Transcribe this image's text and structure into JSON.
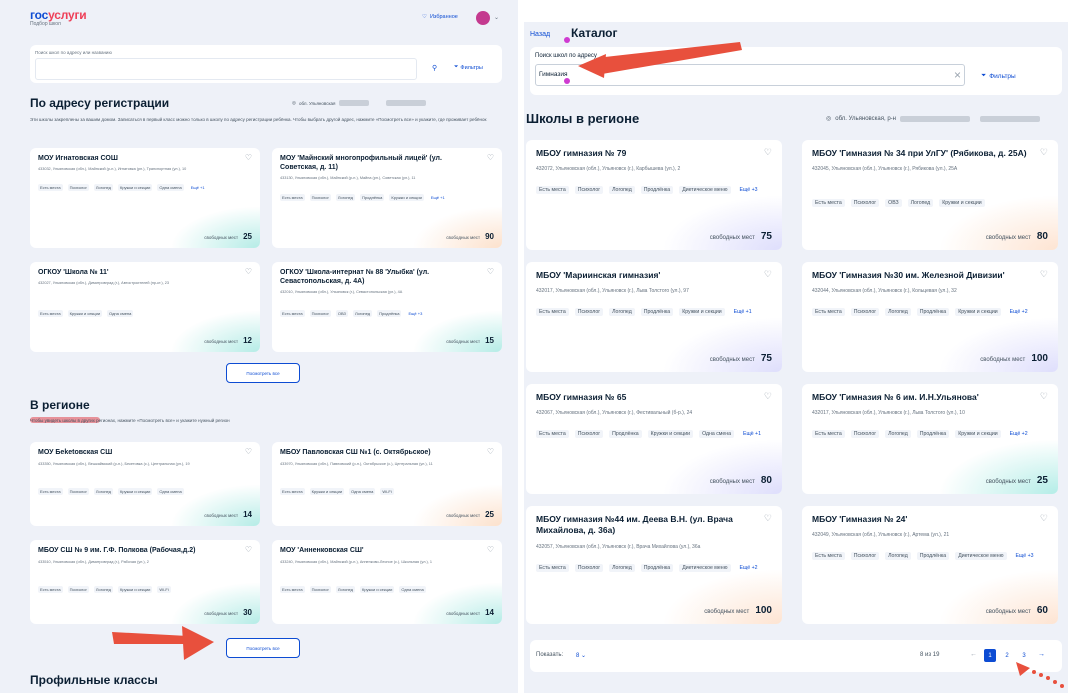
{
  "left": {
    "logo": {
      "part1": "гос",
      "part2": "услуги",
      "sub": "Подбор школ"
    },
    "header": {
      "favorites": "Избранное"
    },
    "search": {
      "label": "Поиск школ по адресу или названию",
      "filters": "Фильтры"
    },
    "section1": {
      "title": "По адресу регистрации",
      "region": "обл. Ульяновская",
      "note": "Эти школы закреплены за вашим домом. Записаться в первый класс можно только в школу по адресу регистрации ребёнка. Чтобы выбрать другой адрес, нажмите «Посмотреть все» и укажите, где проживает ребёнок"
    },
    "cards1": [
      {
        "name": "МОУ Игнатовская СОШ",
        "address": "433032, Ульяновская (обл.), Майнский (р-н.), Игнатовка (рп.), Транспортная (ул.), 10",
        "tags": [
          "Есть места",
          "Психолог",
          "Логопед",
          "Кружки и секции",
          "Одна смена",
          "Ещё +1"
        ],
        "free_label": "свободных мест",
        "free": "25"
      },
      {
        "name": "МОУ 'Майнский многопрофильный лицей' (ул. Советская, д. 11)",
        "address": "433130, Ульяновская (обл.), Майнский (р-н.), Майна (рп.), Советская (ул.), 11",
        "tags": [
          "Есть места",
          "Психолог",
          "Логопед",
          "Продлёнка",
          "Кружки и секции",
          "Ещё +1"
        ],
        "free_label": "свободных мест",
        "free": "90"
      },
      {
        "name": "ОГКОУ 'Школа № 11'",
        "address": "432027, Ульяновская (обл.), Димитровград (г.), Автостроителей (пр-кт.), 23",
        "tags": [
          "Есть места",
          "Кружки и секции",
          "Одна смена"
        ],
        "free_label": "свободных мест",
        "free": "12"
      },
      {
        "name": "ОГКОУ 'Школа-интернат № 88 'Улыбка' (ул. Севастопольская, д. 4А)",
        "address": "432010, Ульяновская (обл.), Ульяновск (г.), Севастопольская (ул.), 4А",
        "tags": [
          "Есть места",
          "Психолог",
          "ОВЗ",
          "Логопед",
          "Продлёнка",
          "Ещё +3"
        ],
        "free_label": "свободных мест",
        "free": "15"
      }
    ],
    "view_all1": "Посмотреть все",
    "section2": {
      "title": "В регионе",
      "note": "Чтобы увидеть школы в других регионах, нажмите «Посмотреть все» и укажите нужный регион"
    },
    "cards2": [
      {
        "name": "МОУ Беketовская СШ",
        "address": "433350, Ульяновская (обл.), Вешкаймский (р-н.), Бекетовка (с.), Центральная (ул.), 19",
        "tags": [
          "Есть места",
          "Психолог",
          "Логопед",
          "Кружки и секции",
          "Одна смена"
        ],
        "free_label": "свободных мест",
        "free": "14"
      },
      {
        "name": "МБОУ Павловская СШ №1 (с. Октябрьское)",
        "address": "433970, Ульяновская (обл.), Павловский (р-н.), Октябрьское (с.), Центральная (ул.), 11",
        "tags": [
          "Есть места",
          "Кружки и секции",
          "Одна смена",
          "Wi-Fi"
        ],
        "free_label": "свободных мест",
        "free": "25"
      },
      {
        "name": "МБОУ СШ № 9 им. Г.Ф. Полкова (Рабочая,д.2)",
        "address": "433510, Ульяновская (обл.), Димитровград (г.), Рабочая (ул.), 2",
        "tags": [
          "Есть места",
          "Психолог",
          "Логопед",
          "Кружки и секции",
          "Wi-Fi"
        ],
        "free_label": "свободных мест",
        "free": "30"
      },
      {
        "name": "МОУ 'Анненковская СШ'",
        "address": "433240, Ульяновская (обл.), Майнский (р-н.), Анненково-Лесное (с.), Школьная (ул.), 1",
        "tags": [
          "Есть места",
          "Психолог",
          "Логопед",
          "Кружки и секции",
          "Одна смена"
        ],
        "free_label": "свободных мест",
        "free": "14"
      }
    ],
    "view_all2": "Посмотреть все",
    "section3": {
      "title": "Профильные классы"
    }
  },
  "right": {
    "back": "Назад",
    "title": "Каталог",
    "search": {
      "label": "Поиск школ по адресу",
      "value": "Гимназия",
      "filters": "Фильтры"
    },
    "section_title": "Школы в регионе",
    "region": "обл. Ульяновская, р-н",
    "cards": [
      {
        "name": "МБОУ гимназия № 79",
        "address": "432072, Ульяновская (обл.), Ульяновск (г.), Карбышева (ул.), 2",
        "tags": [
          "Есть места",
          "Психолог",
          "Логопед",
          "Продлёнка",
          "Диетическое меню",
          "Ещё +3"
        ],
        "free_label": "свободных мест",
        "free": "75"
      },
      {
        "name": "МБОУ 'Гимназия № 34 при УлГУ' (Рябикова, д. 25А)",
        "address": "432045, Ульяновская (обл.), Ульяновск (г.), Рябикова (ул.), 25А",
        "tags": [
          "Есть места",
          "Психолог",
          "ОВЗ",
          "Логопед",
          "Кружки и секции"
        ],
        "free_label": "свободных мест",
        "free": "80"
      },
      {
        "name": "МБОУ 'Мариинская гимназия'",
        "address": "432017, Ульяновская (обл.), Ульяновск (г.), Льва Толстого (ул.), 97",
        "tags": [
          "Есть места",
          "Психолог",
          "Логопед",
          "Продлёнка",
          "Кружки и секции",
          "Ещё +1"
        ],
        "free_label": "свободных мест",
        "free": "75"
      },
      {
        "name": "МБОУ 'Гимназия №30 им. Железной Дивизии'",
        "address": "432044, Ульяновская (обл.), Ульяновск (г.), Кольцевая (ул.), 32",
        "tags": [
          "Есть места",
          "Психолог",
          "Логопед",
          "Продлёнка",
          "Кружки и секции",
          "Ещё +2"
        ],
        "free_label": "свободных мест",
        "free": "100"
      },
      {
        "name": "МБОУ гимназия № 65",
        "address": "432067, Ульяновская (обл.), Ульяновск (г.), Фестивальный (б-р.), 24",
        "tags": [
          "Есть места",
          "Психолог",
          "Продлёнка",
          "Кружки и секции",
          "Одна смена",
          "Ещё +1"
        ],
        "free_label": "свободных мест",
        "free": "80"
      },
      {
        "name": "МБОУ 'Гимназия № 6 им. И.Н.Ульянова'",
        "address": "432017, Ульяновская (обл.), Ульяновск (г.), Льва Толстого (ул.), 10",
        "tags": [
          "Есть места",
          "Психолог",
          "Логопед",
          "Продлёнка",
          "Кружки и секции",
          "Ещё +2"
        ],
        "free_label": "свободных мест",
        "free": "25"
      },
      {
        "name": "МБОУ гимназия №44 им. Деева В.Н. (ул. Врача Михайлова, д. 36а)",
        "address": "432057, Ульяновская (обл.), Ульяновск (г.), Врача Михайлова (ул.), 36а",
        "tags": [
          "Есть места",
          "Психолог",
          "Логопед",
          "Продлёнка",
          "Диетическое меню",
          "Ещё +2"
        ],
        "free_label": "свободных мест",
        "free": "100"
      },
      {
        "name": "МБОУ 'Гимназия № 24'",
        "address": "432049, Ульяновская (обл.), Ульяновск (г.), Артема (ул.), 21",
        "tags": [
          "Есть места",
          "Психолог",
          "Логопед",
          "Продлёнка",
          "Диетическое меню",
          "Ещё +3"
        ],
        "free_label": "свободных мест",
        "free": "60"
      }
    ],
    "pagination": {
      "show_label": "Показать:",
      "show_value": "8",
      "count": "8 из 19",
      "pages": [
        "1",
        "2",
        "3"
      ]
    }
  },
  "colors": {
    "accent": "#0d4cd3",
    "annotation": "#e8503d",
    "marker": "#cf3bd1"
  }
}
